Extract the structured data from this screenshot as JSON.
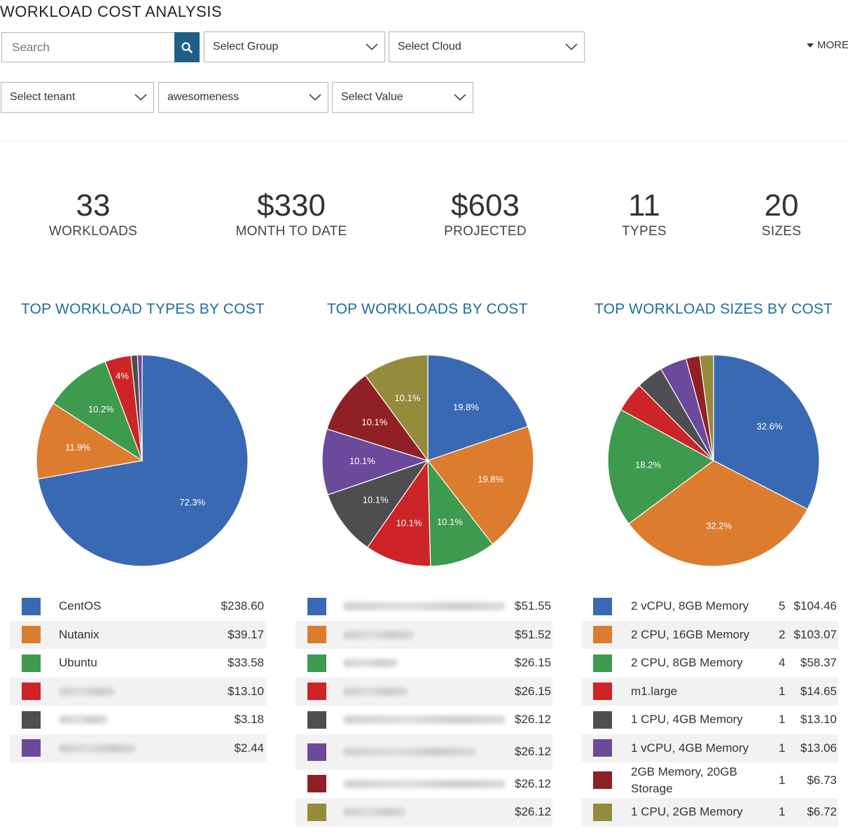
{
  "page": {
    "title": "WORKLOAD COST ANALYSIS"
  },
  "filters": {
    "search_placeholder": "Search",
    "group": "Select Group",
    "cloud": "Select Cloud",
    "more": "MORE",
    "tenant": "Select tenant",
    "awesomeness": "awesomeness",
    "value": "Select Value"
  },
  "stats": {
    "workloads": {
      "value": "33",
      "label": "WORKLOADS"
    },
    "month_to_date": {
      "value": "$330",
      "label": "MONTH TO DATE"
    },
    "projected": {
      "value": "$603",
      "label": "PROJECTED"
    },
    "types": {
      "value": "11",
      "label": "TYPES"
    },
    "sizes": {
      "value": "20",
      "label": "SIZES"
    }
  },
  "colors": {
    "blue": "#3a69b3",
    "orange": "#dc7c2f",
    "green": "#3d9a4e",
    "red": "#cd2428",
    "dark_gray": "#4e4d50",
    "purple": "#6b4a9c",
    "dark_red": "#8f2026",
    "olive": "#948b3d",
    "accent": "#1c6f9c"
  },
  "chart_data": [
    {
      "type": "pie",
      "title": "TOP WORKLOAD TYPES BY COST",
      "slices": [
        {
          "label": "CentOS",
          "value": 72.3,
          "display": "72.3%",
          "cost": "$238.60",
          "color": "#3a69b3"
        },
        {
          "label": "Nutanix",
          "value": 11.9,
          "display": "11.9%",
          "cost": "$39.17",
          "color": "#dc7c2f"
        },
        {
          "label": "Ubuntu",
          "value": 10.2,
          "display": "10.2%",
          "cost": "$33.58",
          "color": "#3d9a4e"
        },
        {
          "label": "",
          "value": 4.0,
          "display": "4%",
          "cost": "$13.10",
          "color": "#cd2428"
        },
        {
          "label": "",
          "value": 1.0,
          "display": "",
          "cost": "$3.18",
          "color": "#4e4d50"
        },
        {
          "label": "",
          "value": 0.7,
          "display": "",
          "cost": "$2.44",
          "color": "#6b4a9c"
        }
      ]
    },
    {
      "type": "pie",
      "title": "TOP WORKLOADS BY COST",
      "slices": [
        {
          "label": "",
          "value": 19.8,
          "display": "19.8%",
          "cost": "$51.55",
          "color": "#3a69b3"
        },
        {
          "label": "",
          "value": 19.8,
          "display": "19.8%",
          "cost": "$51.52",
          "color": "#dc7c2f"
        },
        {
          "label": "",
          "value": 10.1,
          "display": "10.1%",
          "cost": "$26.15",
          "color": "#3d9a4e"
        },
        {
          "label": "",
          "value": 10.1,
          "display": "10.1%",
          "cost": "$26.15",
          "color": "#cd2428"
        },
        {
          "label": "",
          "value": 10.1,
          "display": "10.1%",
          "cost": "$26.12",
          "color": "#4e4d50"
        },
        {
          "label": "",
          "value": 10.1,
          "display": "10.1%",
          "cost": "$26.12",
          "color": "#6b4a9c"
        },
        {
          "label": "",
          "value": 10.1,
          "display": "10.1%",
          "cost": "$26.12",
          "color": "#8f2026"
        },
        {
          "label": "",
          "value": 10.1,
          "display": "10.1%",
          "cost": "$26.12",
          "color": "#948b3d"
        }
      ]
    },
    {
      "type": "pie",
      "title": "TOP WORKLOAD SIZES BY COST",
      "slices": [
        {
          "label": "2 vCPU, 8GB Memory",
          "count": "5",
          "value": 32.6,
          "display": "32.6%",
          "cost": "$104.46",
          "color": "#3a69b3"
        },
        {
          "label": "2 CPU, 16GB Memory",
          "count": "2",
          "value": 32.2,
          "display": "32.2%",
          "cost": "$103.07",
          "color": "#dc7c2f"
        },
        {
          "label": "2 CPU, 8GB Memory",
          "count": "4",
          "value": 18.2,
          "display": "18.2%",
          "cost": "$58.37",
          "color": "#3d9a4e"
        },
        {
          "label": "m1.large",
          "count": "1",
          "value": 4.6,
          "display": "",
          "cost": "$14.65",
          "color": "#cd2428"
        },
        {
          "label": "1 CPU, 4GB Memory",
          "count": "1",
          "value": 4.1,
          "display": "",
          "cost": "$13.10",
          "color": "#4e4d50"
        },
        {
          "label": "1 vCPU, 4GB Memory",
          "count": "1",
          "value": 4.1,
          "display": "",
          "cost": "$13.06",
          "color": "#6b4a9c"
        },
        {
          "label": "2GB Memory, 20GB Storage",
          "count": "1",
          "value": 2.1,
          "display": "",
          "cost": "$6.73",
          "color": "#8f2026"
        },
        {
          "label": "1 CPU, 2GB Memory",
          "count": "1",
          "value": 2.1,
          "display": "",
          "cost": "$6.72",
          "color": "#948b3d"
        }
      ]
    }
  ]
}
